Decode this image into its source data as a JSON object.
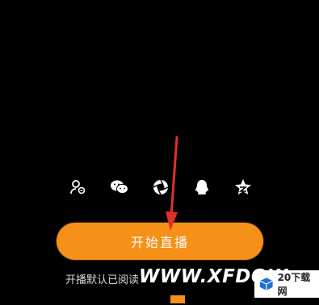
{
  "share": {
    "items": [
      {
        "icon": "user-friends-icon"
      },
      {
        "icon": "wechat-icon"
      },
      {
        "icon": "moments-icon"
      },
      {
        "icon": "qq-icon"
      },
      {
        "icon": "qzone-icon"
      }
    ]
  },
  "start_button": {
    "label": "开始直播"
  },
  "agreement": {
    "text": "开播默认已阅读"
  },
  "watermark": {
    "text": "WWW.XFDOW",
    "logo_text": "20下载网"
  },
  "colors": {
    "accent": "#f59018",
    "background": "#000000",
    "arrow": "#e0302a"
  }
}
